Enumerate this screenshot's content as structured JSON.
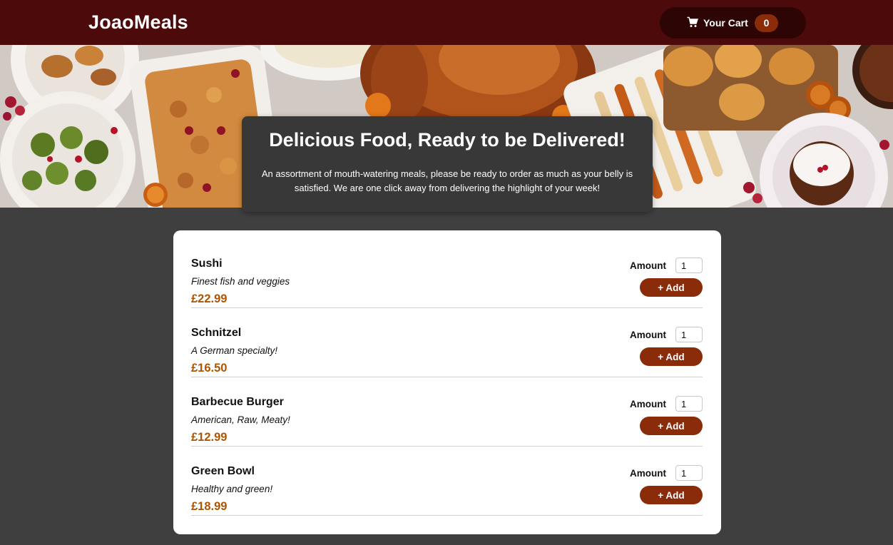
{
  "header": {
    "logo": "JoaoMeals",
    "cart": {
      "icon": "cart-icon",
      "label": "Your Cart",
      "count": "0"
    }
  },
  "intro": {
    "title": "Delicious Food, Ready to be Delivered!",
    "text": "An assortment of mouth-watering meals, please be ready to order as much as your belly is satisfied. We are one click away from delivering the highlight of your week!"
  },
  "meals": [
    {
      "name": "Sushi",
      "description": "Finest fish and veggies",
      "price": "£22.99",
      "amount_label": "Amount",
      "amount": "1",
      "add_label": "+ Add"
    },
    {
      "name": "Schnitzel",
      "description": "A German specialty!",
      "price": "£16.50",
      "amount_label": "Amount",
      "amount": "1",
      "add_label": "+ Add"
    },
    {
      "name": "Barbecue Burger",
      "description": "American, Raw, Meaty!",
      "price": "£12.99",
      "amount_label": "Amount",
      "amount": "1",
      "add_label": "+ Add"
    },
    {
      "name": "Green Bowl",
      "description": "Healthy and green!",
      "price": "£18.99",
      "amount_label": "Amount",
      "amount": "1",
      "add_label": "+ Add"
    }
  ],
  "colors": {
    "header": "#4d0a0b",
    "cart_button": "#2d0504",
    "accent": "#8a2b0a",
    "price": "#ad5502",
    "page_background": "#3f3f3f"
  }
}
